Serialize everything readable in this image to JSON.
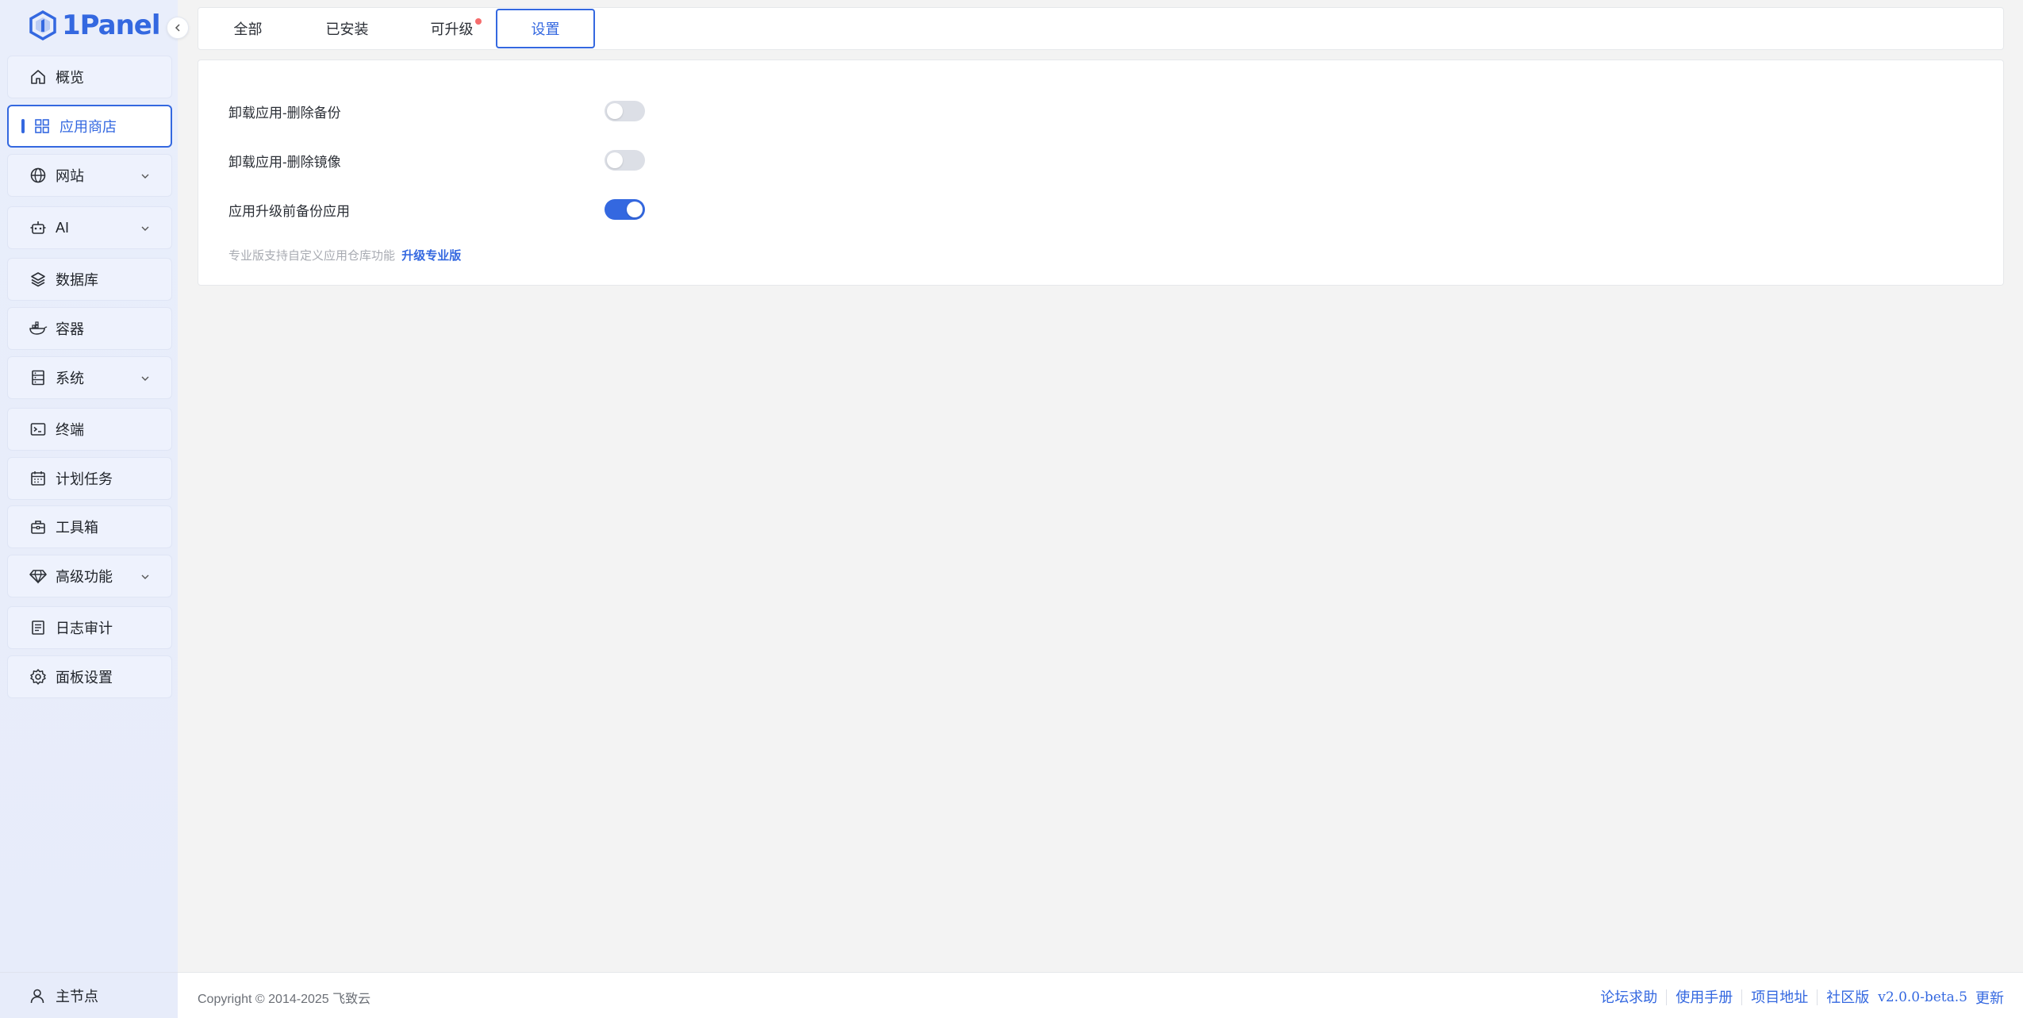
{
  "app": {
    "logo_text": "1Panel"
  },
  "sidebar": {
    "items": [
      {
        "label": "概览",
        "icon": "home-icon"
      },
      {
        "label": "应用商店",
        "icon": "grid-icon",
        "active": true
      },
      {
        "label": "网站",
        "icon": "globe-icon",
        "expandable": true
      },
      {
        "label": "AI",
        "icon": "robot-icon",
        "expandable": true
      },
      {
        "label": "数据库",
        "icon": "layers-icon"
      },
      {
        "label": "容器",
        "icon": "docker-icon"
      },
      {
        "label": "系统",
        "icon": "server-icon",
        "expandable": true
      },
      {
        "label": "终端",
        "icon": "terminal-icon"
      },
      {
        "label": "计划任务",
        "icon": "calendar-icon"
      },
      {
        "label": "工具箱",
        "icon": "toolbox-icon"
      },
      {
        "label": "高级功能",
        "icon": "diamond-icon",
        "expandable": true
      },
      {
        "label": "日志审计",
        "icon": "log-icon"
      },
      {
        "label": "面板设置",
        "icon": "gear-icon"
      }
    ],
    "footer": {
      "label": "主节点",
      "icon": "user-icon"
    }
  },
  "tabs": [
    {
      "label": "全部"
    },
    {
      "label": "已安装"
    },
    {
      "label": "可升级",
      "badge": true
    },
    {
      "label": "设置",
      "active": true
    }
  ],
  "settings": {
    "rows": [
      {
        "label": "卸载应用-删除备份",
        "enabled": false
      },
      {
        "label": "卸载应用-删除镜像",
        "enabled": false
      },
      {
        "label": "应用升级前备份应用",
        "enabled": true
      }
    ],
    "hint_text": "专业版支持自定义应用仓库功能",
    "hint_link": "升级专业版"
  },
  "footer": {
    "copyright": "Copyright © 2014-2025 飞致云",
    "links": [
      "论坛求助",
      "使用手册",
      "项目地址",
      "社区版"
    ],
    "version": "v2.0.0-beta.5",
    "update": "更新"
  },
  "colors": {
    "accent": "#3468e0",
    "badge": "#f56c6c"
  }
}
